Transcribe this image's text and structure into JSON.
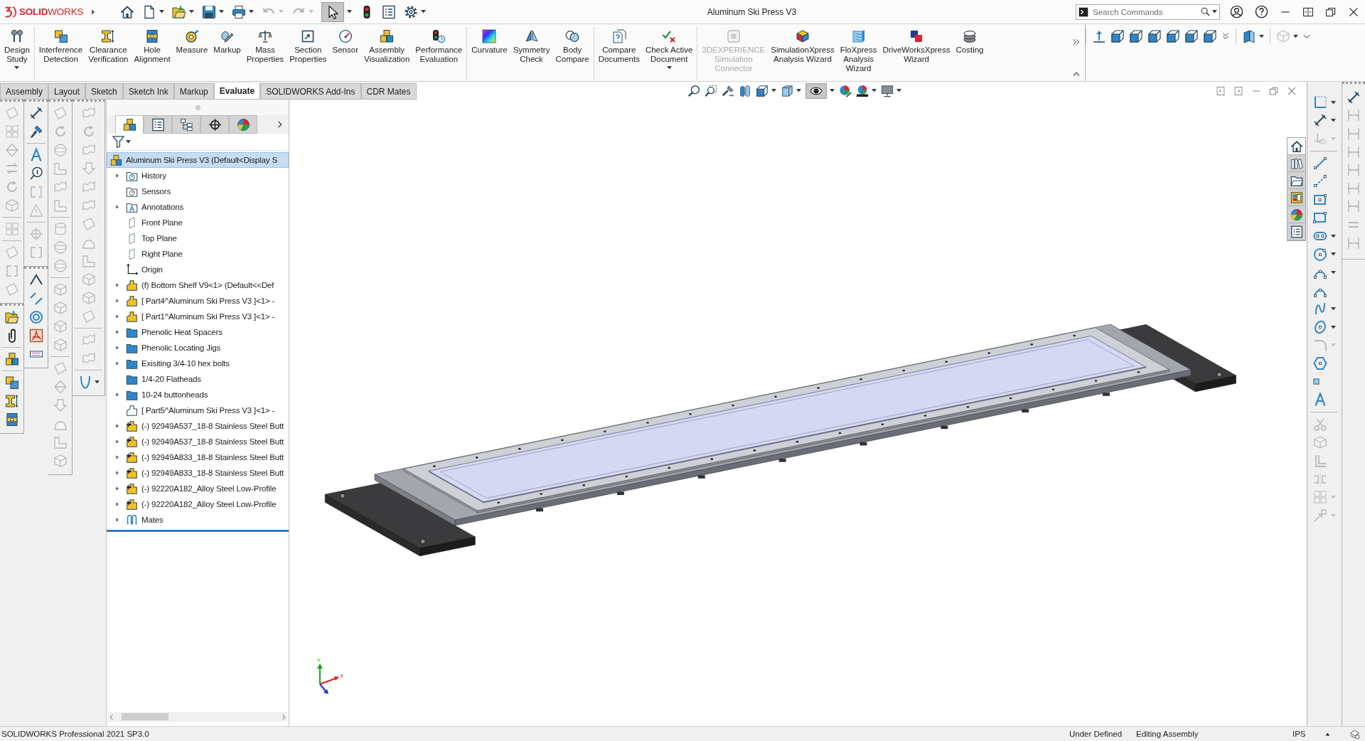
{
  "title_bar": {
    "logo": "**SOLID**WORKS",
    "title": "Aluminum Ski Press V3",
    "search": {
      "placeholder": "Search Commands"
    }
  },
  "quick_access": [
    {
      "kind": "house",
      "dropdown": false,
      "selected": false,
      "disabled": false
    },
    {
      "kind": "page",
      "dropdown": true,
      "selected": false,
      "disabled": false
    },
    {
      "kind": "open-folder",
      "dropdown": true,
      "selected": false,
      "disabled": false
    },
    {
      "kind": "floppy",
      "dropdown": true,
      "selected": false,
      "disabled": false
    },
    {
      "kind": "printer",
      "dropdown": true,
      "selected": false,
      "disabled": false
    },
    {
      "kind": "undo",
      "dropdown": true,
      "selected": false,
      "disabled": true
    },
    {
      "kind": "redo",
      "dropdown": true,
      "selected": false,
      "disabled": true
    },
    {
      "kind": "pointer",
      "dropdown": true,
      "selected": true,
      "disabled": false
    },
    {
      "kind": "traffic-light",
      "dropdown": false,
      "selected": false,
      "disabled": false
    },
    {
      "kind": "list",
      "dropdown": false,
      "selected": false,
      "disabled": false
    },
    {
      "kind": "gear",
      "dropdown": true,
      "selected": false,
      "disabled": false
    }
  ],
  "ribbon": {
    "groups": [
      [
        {
          "kind": "pins",
          "label": [
            "Design",
            "Study"
          ],
          "dropdown": true,
          "disabled": false
        }
      ],
      [
        {
          "kind": "cube-pair",
          "label": [
            "Interference",
            "Detection"
          ],
          "dropdown": false,
          "disabled": false
        },
        {
          "kind": "ibeam",
          "label": [
            "Clearance",
            "Verification"
          ],
          "dropdown": false,
          "disabled": false
        },
        {
          "kind": "hole-block",
          "label": [
            "Hole",
            "Alignment"
          ],
          "dropdown": false,
          "disabled": false
        },
        {
          "kind": "tape",
          "label": [
            "Measure"
          ],
          "dropdown": false,
          "disabled": false
        },
        {
          "kind": "pen",
          "label": [
            "Markup"
          ],
          "dropdown": false,
          "disabled": false
        },
        {
          "kind": "scale",
          "label": [
            "Mass",
            "Properties"
          ],
          "dropdown": false,
          "disabled": false
        },
        {
          "kind": "arrow-square",
          "label": [
            "Section",
            "Properties"
          ],
          "dropdown": false,
          "disabled": false
        },
        {
          "kind": "gauge",
          "label": [
            "Sensor"
          ],
          "dropdown": false,
          "disabled": false
        },
        {
          "kind": "cube-stack",
          "label": [
            "Assembly",
            "Visualization"
          ],
          "dropdown": false,
          "disabled": false
        },
        {
          "kind": "traffic-clock",
          "label": [
            "Performance",
            "Evaluation"
          ],
          "dropdown": false,
          "disabled": false
        }
      ],
      [
        {
          "kind": "rainbow-square",
          "label": [
            "Curvature"
          ],
          "dropdown": false,
          "disabled": false
        },
        {
          "kind": "wings",
          "label": [
            "Symmetry",
            "Check"
          ],
          "dropdown": false,
          "disabled": false
        },
        {
          "kind": "overlap-circles",
          "label": [
            "Body",
            "Compare"
          ],
          "dropdown": false,
          "disabled": false
        }
      ],
      [
        {
          "kind": "documents",
          "label": [
            "Compare",
            "Documents"
          ],
          "dropdown": false,
          "disabled": false
        },
        {
          "kind": "check-cross",
          "label": [
            "Check Active",
            "Document"
          ],
          "dropdown": true,
          "disabled": false
        }
      ],
      [
        {
          "kind": "framed-square",
          "label": [
            "3DEXPERIENCE",
            "Simulation",
            "Connector"
          ],
          "dropdown": false,
          "disabled": true
        },
        {
          "kind": "color-cube",
          "label": [
            "SimulationXpress",
            "Analysis Wizard"
          ],
          "dropdown": false,
          "disabled": false
        },
        {
          "kind": "wavy-page",
          "label": [
            "FloXpress",
            "Analysis",
            "Wizard"
          ],
          "dropdown": false,
          "disabled": false
        },
        {
          "kind": "squares",
          "label": [
            "DriveWorksXpress",
            "Wizard"
          ],
          "dropdown": false,
          "disabled": false
        },
        {
          "kind": "coins",
          "label": [
            "Costing"
          ],
          "dropdown": false,
          "disabled": false
        }
      ]
    ],
    "view_groups": [
      [
        {
          "kind": "up-arrow",
          "dropdown": false,
          "disabled": false
        },
        {
          "kind": "cube-view",
          "dropdown": false,
          "disabled": false
        },
        {
          "kind": "cube-view",
          "dropdown": false,
          "disabled": false
        },
        {
          "kind": "cube-view",
          "dropdown": false,
          "disabled": false
        },
        {
          "kind": "cube-view",
          "dropdown": false,
          "disabled": false
        },
        {
          "kind": "cube-view",
          "dropdown": false,
          "disabled": false
        },
        {
          "kind": "cube-view",
          "dropdown": false,
          "disabled": false
        },
        {
          "kind": "double-chevron-down",
          "dropdown": false,
          "disabled": false
        }
      ],
      [
        {
          "kind": "folded-panel",
          "dropdown": true,
          "disabled": false
        }
      ],
      [
        {
          "kind": "display-cube",
          "dropdown": true,
          "disabled": true
        },
        {
          "kind": "chevron-down",
          "dropdown": false,
          "disabled": false
        }
      ]
    ]
  },
  "command_tabs": [
    {
      "label": "Assembly",
      "selected": false
    },
    {
      "label": "Layout",
      "selected": false
    },
    {
      "label": "Sketch",
      "selected": false
    },
    {
      "label": "Sketch Ink",
      "selected": false
    },
    {
      "label": "Markup",
      "selected": false
    },
    {
      "label": "Evaluate",
      "selected": true
    },
    {
      "label": "SOLIDWORKS Add-Ins",
      "selected": false
    },
    {
      "label": "CDR Mates",
      "selected": false
    }
  ],
  "view_toolbar": [
    {
      "kind": "magnifier",
      "selected": false,
      "dropdown": false
    },
    {
      "kind": "magnifier-box",
      "selected": false,
      "dropdown": false
    },
    {
      "kind": "flashlight",
      "selected": false,
      "dropdown": false
    },
    {
      "kind": "half-cylinders",
      "selected": false,
      "dropdown": false
    },
    {
      "kind": "cube-view",
      "selected": false,
      "dropdown": true
    },
    {
      "kind": "cube-solid",
      "selected": false,
      "dropdown": true
    },
    {
      "kind": "eye",
      "selected": true,
      "dropdown": true
    },
    {
      "kind": "color-ball-pen",
      "selected": false,
      "dropdown": false
    },
    {
      "kind": "color-ball-scene",
      "selected": false,
      "dropdown": true
    },
    {
      "kind": "monitor",
      "selected": false,
      "dropdown": true
    }
  ],
  "left_toolbars": [
    [
      [
        [
          {
            "kind": "sheet",
            "disabled": true,
            "dropdown": false
          },
          {
            "kind": "grid",
            "disabled": true,
            "dropdown": false
          },
          {
            "kind": "gem",
            "disabled": true,
            "dropdown": false
          },
          {
            "kind": "swap",
            "disabled": true,
            "dropdown": false
          },
          {
            "kind": "curl",
            "disabled": true,
            "dropdown": false
          },
          {
            "kind": "box",
            "disabled": true,
            "dropdown": false
          }
        ],
        [
          {
            "kind": "grid",
            "disabled": true,
            "dropdown": false
          }
        ],
        [
          {
            "kind": "sheet",
            "disabled": true,
            "dropdown": false
          },
          {
            "kind": "bracket",
            "disabled": true,
            "dropdown": false
          },
          {
            "kind": "sheet",
            "disabled": true,
            "dropdown": false
          }
        ]
      ],
      [
        [
          {
            "kind": "open-folder",
            "disabled": false,
            "dropdown": false
          },
          {
            "kind": "paperclip",
            "disabled": false,
            "dropdown": false
          }
        ],
        [
          {
            "kind": "cube-stack",
            "disabled": false,
            "dropdown": false
          }
        ],
        [
          {
            "kind": "cube-pair",
            "disabled": false,
            "dropdown": false
          },
          {
            "kind": "ibeam",
            "disabled": false,
            "dropdown": false
          },
          {
            "kind": "hole-block",
            "disabled": false,
            "dropdown": false
          }
        ]
      ]
    ],
    [
      [
        [
          {
            "kind": "dimension",
            "disabled": false,
            "dropdown": false
          },
          {
            "kind": "brush",
            "disabled": false,
            "dropdown": false
          }
        ],
        [
          {
            "kind": "letter-a",
            "disabled": false,
            "dropdown": false
          },
          {
            "kind": "balloon",
            "disabled": false,
            "dropdown": false
          },
          {
            "kind": "bracket",
            "disabled": true,
            "dropdown": false
          },
          {
            "kind": "triangle",
            "disabled": true,
            "dropdown": false
          }
        ],
        [
          {
            "kind": "crosshair",
            "disabled": true,
            "dropdown": false
          },
          {
            "kind": "bracket",
            "disabled": true,
            "dropdown": false
          }
        ]
      ],
      [
        [
          {
            "kind": "angle-line",
            "disabled": false,
            "dropdown": false
          },
          {
            "kind": "parallel-lines",
            "disabled": false,
            "dropdown": false
          },
          {
            "kind": "ring",
            "disabled": false,
            "dropdown": false
          },
          {
            "kind": "pdf-sheet",
            "disabled": false,
            "dropdown": false
          },
          {
            "kind": "hatch",
            "disabled": false,
            "dropdown": false
          }
        ]
      ]
    ],
    [
      [
        [
          {
            "kind": "sheet",
            "disabled": true,
            "dropdown": false
          },
          {
            "kind": "curl",
            "disabled": true,
            "dropdown": false
          },
          {
            "kind": "sphere",
            "disabled": true,
            "dropdown": false
          },
          {
            "kind": "bend",
            "disabled": true,
            "dropdown": false
          },
          {
            "kind": "wave",
            "disabled": true,
            "dropdown": false
          },
          {
            "kind": "bend",
            "disabled": true,
            "dropdown": false
          }
        ],
        [
          {
            "kind": "cylinder",
            "disabled": true,
            "dropdown": false
          },
          {
            "kind": "sphere",
            "disabled": true,
            "dropdown": false
          },
          {
            "kind": "sphere",
            "disabled": true,
            "dropdown": false
          }
        ],
        [
          {
            "kind": "box",
            "disabled": true,
            "dropdown": false
          },
          {
            "kind": "box",
            "disabled": true,
            "dropdown": false
          },
          {
            "kind": "box",
            "disabled": true,
            "dropdown": false
          },
          {
            "kind": "box",
            "disabled": true,
            "dropdown": false
          }
        ],
        [
          {
            "kind": "sheet",
            "disabled": true,
            "dropdown": false
          },
          {
            "kind": "gem",
            "disabled": true,
            "dropdown": false
          },
          {
            "kind": "down-arrow",
            "disabled": true,
            "dropdown": false
          },
          {
            "kind": "dome",
            "disabled": true,
            "dropdown": false
          },
          {
            "kind": "bend",
            "disabled": true,
            "dropdown": false
          },
          {
            "kind": "box",
            "disabled": true,
            "dropdown": false
          }
        ]
      ]
    ],
    [
      [
        [
          {
            "kind": "wave",
            "disabled": true,
            "dropdown": false
          },
          {
            "kind": "curl",
            "disabled": true,
            "dropdown": false
          },
          {
            "kind": "wave",
            "disabled": true,
            "dropdown": false
          },
          {
            "kind": "down-arrow",
            "disabled": true,
            "dropdown": false
          },
          {
            "kind": "wave",
            "disabled": true,
            "dropdown": false
          },
          {
            "kind": "wave",
            "disabled": true,
            "dropdown": false
          },
          {
            "kind": "sheet",
            "disabled": true,
            "dropdown": false
          },
          {
            "kind": "dome",
            "disabled": true,
            "dropdown": false
          },
          {
            "kind": "bend",
            "disabled": true,
            "dropdown": false
          },
          {
            "kind": "box",
            "disabled": true,
            "dropdown": false
          },
          {
            "kind": "box",
            "disabled": true,
            "dropdown": false
          },
          {
            "kind": "sheet",
            "disabled": true,
            "dropdown": false
          }
        ],
        [
          {
            "kind": "wave",
            "disabled": true,
            "dropdown": false
          },
          {
            "kind": "wave",
            "disabled": true,
            "dropdown": false
          }
        ],
        [
          {
            "kind": "u-curve",
            "disabled": false,
            "dropdown": true
          }
        ]
      ]
    ]
  ],
  "feature_manager": {
    "tabs": [
      {
        "kind": "cube-stack",
        "selected": true
      },
      {
        "kind": "list",
        "selected": false
      },
      {
        "kind": "tree-diagram",
        "selected": false
      },
      {
        "kind": "crosshair",
        "selected": false
      },
      {
        "kind": "color-ball",
        "selected": false
      }
    ],
    "tree": {
      "label": "Aluminum Ski Press V3 (Default<Display S",
      "kind": "cube-stack",
      "selected": true,
      "children": [
        {
          "label": "History",
          "kind": "history-folder",
          "expandable": true,
          "selected": false
        },
        {
          "label": "Sensors",
          "kind": "sensor-folder",
          "expandable": false,
          "selected": false
        },
        {
          "label": "Annotations",
          "kind": "annotation-folder",
          "expandable": true,
          "selected": false
        },
        {
          "label": "Front Plane",
          "kind": "plane",
          "expandable": false,
          "selected": false
        },
        {
          "label": "Top Plane",
          "kind": "plane",
          "expandable": false,
          "selected": false
        },
        {
          "label": "Right Plane",
          "kind": "plane",
          "expandable": false,
          "selected": false
        },
        {
          "label": "Origin",
          "kind": "origin",
          "expandable": false,
          "selected": false
        },
        {
          "label": "(f) Bottom Shelf V9<1> (Default<<Def",
          "kind": "part",
          "expandable": true,
          "selected": false
        },
        {
          "label": "[ Part4^Aluminum Ski Press V3 ]<1> -",
          "kind": "part",
          "expandable": true,
          "selected": false
        },
        {
          "label": "[ Part1^Aluminum Ski Press V3 ]<1> -",
          "kind": "part",
          "expandable": true,
          "selected": false
        },
        {
          "label": "Phenolic Heat Spacers",
          "kind": "folder",
          "expandable": true,
          "selected": false
        },
        {
          "label": "Phenolic Locating Jigs",
          "kind": "folder",
          "expandable": true,
          "selected": false
        },
        {
          "label": "Exisiting 3/4-10 hex bolts",
          "kind": "folder",
          "expandable": true,
          "selected": false
        },
        {
          "label": "1/4-20 Flatheads",
          "kind": "folder",
          "expandable": false,
          "selected": false
        },
        {
          "label": "10-24 buttonheads",
          "kind": "folder",
          "expandable": true,
          "selected": false
        },
        {
          "label": "[ Part5^Aluminum Ski Press V3 ]<1> -",
          "kind": "part-outline",
          "expandable": false,
          "selected": false
        },
        {
          "label": "(-) 92949A537_18-8 Stainless Steel Butt",
          "kind": "fastener",
          "expandable": true,
          "selected": false
        },
        {
          "label": "(-) 92949A537_18-8 Stainless Steel Butt",
          "kind": "fastener",
          "expandable": true,
          "selected": false
        },
        {
          "label": "(-) 92949A833_18-8 Stainless Steel Butt",
          "kind": "fastener",
          "expandable": true,
          "selected": false
        },
        {
          "label": "(-) 92949A833_18-8 Stainless Steel Butt",
          "kind": "fastener",
          "expandable": true,
          "selected": false
        },
        {
          "label": "(-) 92220A182_Alloy Steel Low-Profile",
          "kind": "fastener",
          "expandable": true,
          "selected": false
        },
        {
          "label": "(-) 92220A182_Alloy Steel Low-Profile",
          "kind": "fastener",
          "expandable": true,
          "selected": false
        },
        {
          "label": "Mates",
          "kind": "mates",
          "expandable": true,
          "selected": false
        }
      ]
    }
  },
  "task_pane_tabs": [
    {
      "kind": "house",
      "selected": true
    },
    {
      "kind": "books",
      "selected": false
    },
    {
      "kind": "folder-outline",
      "selected": false
    },
    {
      "kind": "palette-window",
      "selected": false
    },
    {
      "kind": "color-ball",
      "selected": false
    },
    {
      "kind": "list",
      "selected": false
    }
  ],
  "sketch_toolbar": [
    [
      {
        "kind": "sketch-corner",
        "disabled": false,
        "dropdown": true
      },
      {
        "kind": "dimension",
        "disabled": false,
        "dropdown": true
      },
      {
        "kind": "eye-plane",
        "disabled": true,
        "dropdown": true
      }
    ],
    [
      {
        "kind": "line",
        "disabled": false,
        "dropdown": false
      },
      {
        "kind": "centerline",
        "disabled": false,
        "dropdown": false
      },
      {
        "kind": "center-rect",
        "disabled": false,
        "dropdown": false
      },
      {
        "kind": "rect",
        "disabled": false,
        "dropdown": false
      },
      {
        "kind": "slot",
        "disabled": false,
        "dropdown": true
      },
      {
        "kind": "circle",
        "disabled": false,
        "dropdown": true
      },
      {
        "kind": "arc",
        "disabled": false,
        "dropdown": true
      },
      {
        "kind": "arc",
        "disabled": false,
        "dropdown": false
      },
      {
        "kind": "spline",
        "disabled": false,
        "dropdown": true
      },
      {
        "kind": "ellipse",
        "disabled": false,
        "dropdown": true
      },
      {
        "kind": "fillet",
        "disabled": true,
        "dropdown": true
      },
      {
        "kind": "polygon",
        "disabled": false,
        "dropdown": false
      },
      {
        "kind": "point",
        "disabled": false,
        "dropdown": false
      },
      {
        "kind": "letter-a",
        "disabled": false,
        "dropdown": false
      }
    ],
    [
      {
        "kind": "scissors",
        "disabled": true,
        "dropdown": false
      },
      {
        "kind": "box",
        "disabled": true,
        "dropdown": false
      },
      {
        "kind": "offset",
        "disabled": true,
        "dropdown": false
      },
      {
        "kind": "mirror",
        "disabled": true,
        "dropdown": false
      },
      {
        "kind": "grid",
        "disabled": true,
        "dropdown": true
      },
      {
        "kind": "move",
        "disabled": true,
        "dropdown": true
      }
    ]
  ],
  "dimension_toolbar": [
    {
      "kind": "dimension",
      "disabled": false
    },
    {
      "kind": "dim-bracket",
      "disabled": true
    },
    {
      "kind": "dim-bracket",
      "disabled": true
    },
    {
      "kind": "dim-bracket",
      "disabled": true
    },
    {
      "kind": "dim-bracket",
      "disabled": true
    },
    {
      "kind": "dim-bracket",
      "disabled": true
    },
    {
      "kind": "dim-bracket",
      "disabled": true
    },
    {
      "kind": "equal",
      "disabled": true
    },
    {
      "kind": "dim-bracket",
      "disabled": true
    }
  ],
  "triad": {
    "x_label": "X",
    "y_label": "Y"
  },
  "status_bar": {
    "product": "SOLIDWORKS Professional 2021 SP3.0",
    "state": "Under Defined",
    "mode": "Editing Assembly",
    "units": "IPS"
  }
}
